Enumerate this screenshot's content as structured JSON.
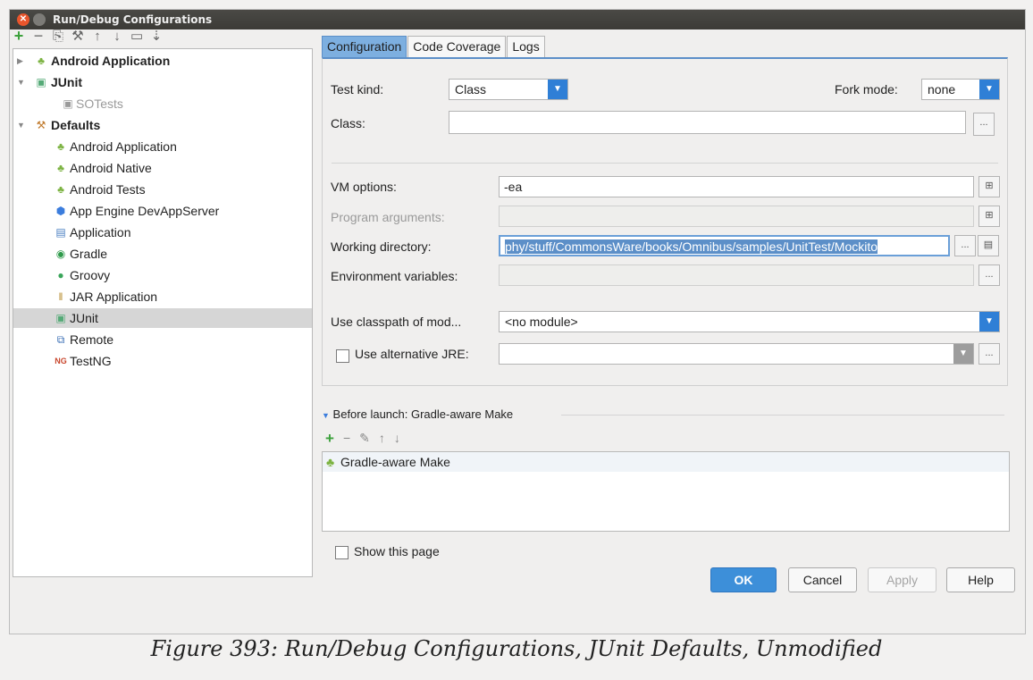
{
  "window": {
    "title": "Run/Debug Configurations"
  },
  "toolbar": {
    "icons": [
      "add-icon",
      "remove-icon",
      "copy-icon",
      "wrench-icon",
      "move-up-icon",
      "move-down-icon",
      "folder-icon",
      "sort-icon"
    ]
  },
  "tree": {
    "android_application": "Android Application",
    "junit": "JUnit",
    "sotests": "SOTests",
    "defaults": "Defaults",
    "defaults_items": [
      "Android Application",
      "Android Native",
      "Android Tests",
      "App Engine DevAppServer",
      "Application",
      "Gradle",
      "Groovy",
      "JAR Application",
      "JUnit",
      "Remote",
      "TestNG"
    ],
    "selected": "JUnit"
  },
  "tabs": [
    "Configuration",
    "Code Coverage",
    "Logs"
  ],
  "form": {
    "test_kind_label": "Test kind:",
    "test_kind_value": "Class",
    "fork_mode_label": "Fork mode:",
    "fork_mode_value": "none",
    "class_label": "Class:",
    "class_value": "",
    "vm_options_label": "VM options:",
    "vm_options_value": "-ea",
    "program_arguments_label": "Program arguments:",
    "program_arguments_value": "",
    "working_directory_label": "Working directory:",
    "working_directory_value": "phy/stuff/CommonsWare/books/Omnibus/samples/UnitTest/Mockito",
    "environment_variables_label": "Environment variables:",
    "environment_variables_value": "",
    "classpath_label": "Use classpath of mod...",
    "classpath_value": "<no module>",
    "alt_jre_label": "Use alternative JRE:",
    "alt_jre_value": "",
    "browse": "..."
  },
  "before_launch": {
    "title": "Before launch: Gradle-aware Make",
    "items": [
      "Gradle-aware Make"
    ],
    "show_page_label": "Show this page"
  },
  "buttons": {
    "ok": "OK",
    "cancel": "Cancel",
    "apply": "Apply",
    "help": "Help"
  },
  "caption": "Figure 393: Run/Debug Configurations, JUnit Defaults, Unmodified",
  "colors": {
    "accent": "#3d8fd9",
    "tab_active": "#7dafe0",
    "android_green": "#7cb342"
  }
}
